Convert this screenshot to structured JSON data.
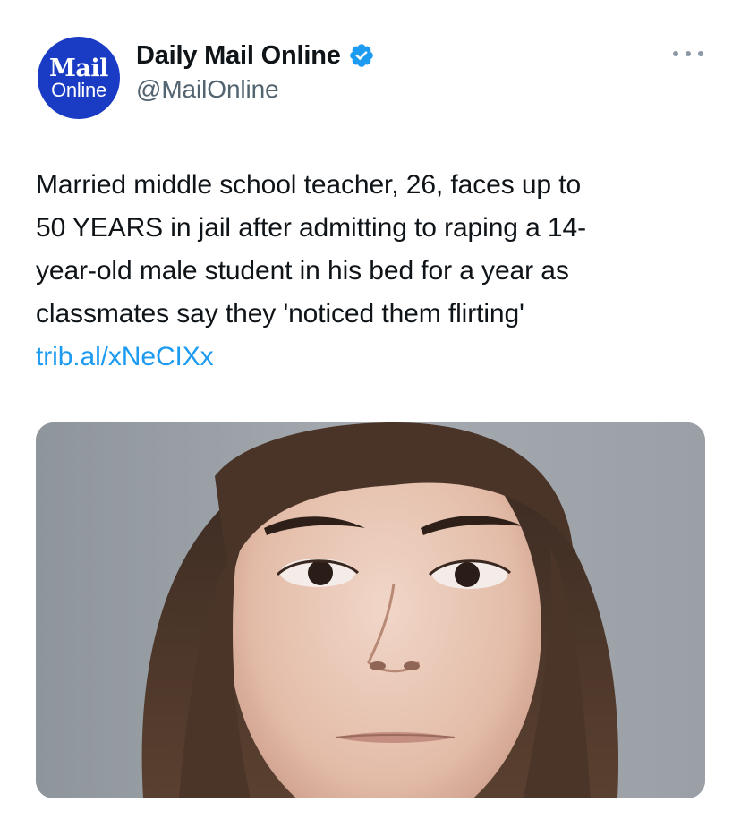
{
  "account": {
    "avatar_line1": "Mail",
    "avatar_line2": "Online",
    "display_name": "Daily Mail Online",
    "handle": "@MailOnline",
    "verified": true,
    "avatar_color": "#1a3cc4",
    "verified_color": "#1d9bf0"
  },
  "menu": {
    "icon": "more-horizontal-icon"
  },
  "tweet": {
    "lines": [
      "Married middle school teacher, 26, faces up to",
      "50 YEARS in jail after admitting to raping a 14-",
      "year-old male student in his bed for a year as",
      "classmates say they 'noticed them flirting'"
    ],
    "link": "trib.al/xNeCIXx",
    "link_color": "#1d9bf0"
  },
  "media": {
    "type": "photo"
  }
}
